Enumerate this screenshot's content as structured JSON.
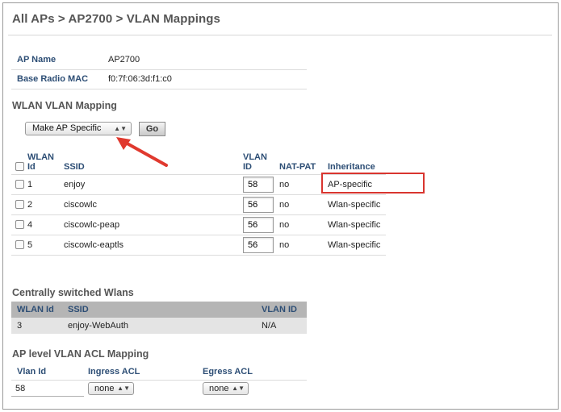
{
  "page_title": "All APs > AP2700 > VLAN Mappings",
  "ap_info": [
    {
      "label": "AP Name",
      "value": "AP2700"
    },
    {
      "label": "Base Radio MAC",
      "value": "f0:7f:06:3d:f1:c0"
    }
  ],
  "wlan_vlan_mapping": {
    "heading": "WLAN VLAN Mapping",
    "action_select": "Make AP Specific",
    "go_label": "Go",
    "columns": {
      "wlan_id_1": "WLAN",
      "wlan_id_2": "Id",
      "ssid": "SSID",
      "vlan_id_1": "VLAN",
      "vlan_id_2": "ID",
      "nat_pat": "NAT-PAT",
      "inheritance": "Inheritance"
    },
    "rows": [
      {
        "id": "1",
        "ssid": "enjoy",
        "vlan": "58",
        "nat": "no",
        "inheritance": "AP-specific"
      },
      {
        "id": "2",
        "ssid": "ciscowlc",
        "vlan": "56",
        "nat": "no",
        "inheritance": "Wlan-specific"
      },
      {
        "id": "4",
        "ssid": "ciscowlc-peap",
        "vlan": "56",
        "nat": "no",
        "inheritance": "Wlan-specific"
      },
      {
        "id": "5",
        "ssid": "ciscowlc-eaptls",
        "vlan": "56",
        "nat": "no",
        "inheritance": "Wlan-specific"
      }
    ]
  },
  "centrally_switched": {
    "heading": "Centrally switched Wlans",
    "columns": {
      "wlan_id": "WLAN Id",
      "ssid": "SSID",
      "vlan_id": "VLAN ID"
    },
    "rows": [
      {
        "id": "3",
        "ssid": "enjoy-WebAuth",
        "vlan": "N/A"
      }
    ]
  },
  "acl_mapping": {
    "heading": "AP level VLAN ACL Mapping",
    "columns": {
      "vlan_id": "Vlan Id",
      "ingress": "Ingress ACL",
      "egress": "Egress ACL"
    },
    "rows": [
      {
        "vlan": "58",
        "ingress": "none",
        "egress": "none"
      }
    ]
  },
  "colors": {
    "header_text": "#2d4e75",
    "highlight": "#d9352f",
    "arrow": "#e0392e"
  }
}
